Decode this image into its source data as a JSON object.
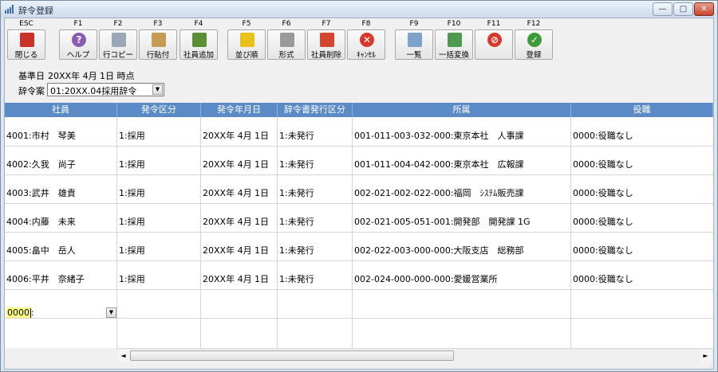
{
  "window": {
    "title": "辞令登録",
    "buttons": {
      "minimize_glyph": "—",
      "maximize_glyph": "□",
      "close_glyph": "✕"
    }
  },
  "toolbar": [
    {
      "key": "ESC",
      "label": "閉じる",
      "icon": "close-window-icon",
      "color": "#c8322b"
    },
    {
      "key": "F1",
      "label": "ヘルプ",
      "icon": "help-icon",
      "color": "#8a5bb0",
      "glyph": "?"
    },
    {
      "key": "F2",
      "label": "行コピー",
      "icon": "copy-row-icon",
      "color": "#9aa7b6"
    },
    {
      "key": "F3",
      "label": "行貼付",
      "icon": "paste-row-icon",
      "color": "#c69b54"
    },
    {
      "key": "F4",
      "label": "社員追加",
      "icon": "add-employee-icon",
      "color": "#5a8f38"
    },
    {
      "key": "F5",
      "label": "並び順",
      "icon": "sort-order-icon",
      "color": "#e8c21a"
    },
    {
      "key": "F6",
      "label": "形式",
      "icon": "format-gear-icon",
      "color": "#9a9a9a"
    },
    {
      "key": "F7",
      "label": "社員削除",
      "icon": "delete-employee-icon",
      "color": "#d2452f"
    },
    {
      "key": "F8",
      "label": "ｷｬﾝｾﾙ",
      "icon": "cancel-icon",
      "color": "#d63a2c",
      "glyph": "✕"
    },
    {
      "key": "F9",
      "label": "一覧",
      "icon": "list-search-icon",
      "color": "#7fa3c8"
    },
    {
      "key": "F10",
      "label": "一括変換",
      "icon": "bulk-convert-icon",
      "color": "#4e9a4e"
    },
    {
      "key": "F11",
      "label": "",
      "icon": "no-entry-icon",
      "color": "#d63a2c",
      "glyph": "⊘"
    },
    {
      "key": "F12",
      "label": "登録",
      "icon": "register-check-icon",
      "color": "#3f9a3a",
      "glyph": "✓"
    }
  ],
  "info": {
    "base_date_label": "基準日",
    "base_date": "20XX年 4月 1日 時点",
    "plan_label": "辞令案",
    "plan_value": "01:20XX.04採用辞令"
  },
  "table": {
    "columns": [
      "社員",
      "発令区分",
      "発令年月日",
      "辞令書発行区分",
      "所属",
      "役職"
    ],
    "rows": [
      [
        "4001:市村　琴美",
        "1:採用",
        "20XX年 4月 1日",
        "1:未発行",
        "001-011-003-032-000:東京本社　人事課",
        "0000:役職なし"
      ],
      [
        "4002:久我　尚子",
        "1:採用",
        "20XX年 4月 1日",
        "1:未発行",
        "001-011-004-042-000:東京本社　広報課",
        "0000:役職なし"
      ],
      [
        "4003:武井　雄貴",
        "1:採用",
        "20XX年 4月 1日",
        "1:未発行",
        "002-021-002-022-000:福岡　ｼｽﾃﾑ販売課",
        "0000:役職なし"
      ],
      [
        "4004:内藤　未来",
        "1:採用",
        "20XX年 4月 1日",
        "1:未発行",
        "002-021-005-051-001:開発部　開発課 1G",
        "0000:役職なし"
      ],
      [
        "4005:畠中　岳人",
        "1:採用",
        "20XX年 4月 1日",
        "1:未発行",
        "002-022-003-000-000:大阪支店　総務部",
        "0000:役職なし"
      ],
      [
        "4006:平井　奈緒子",
        "1:採用",
        "20XX年 4月 1日",
        "1:未発行",
        "002-024-000-000-000:愛媛営業所",
        "0000:役職なし"
      ]
    ],
    "new_row": {
      "code": "0000",
      "separator": ":"
    }
  },
  "scrollbar": {
    "left_glyph": "◄",
    "right_glyph": "►"
  }
}
